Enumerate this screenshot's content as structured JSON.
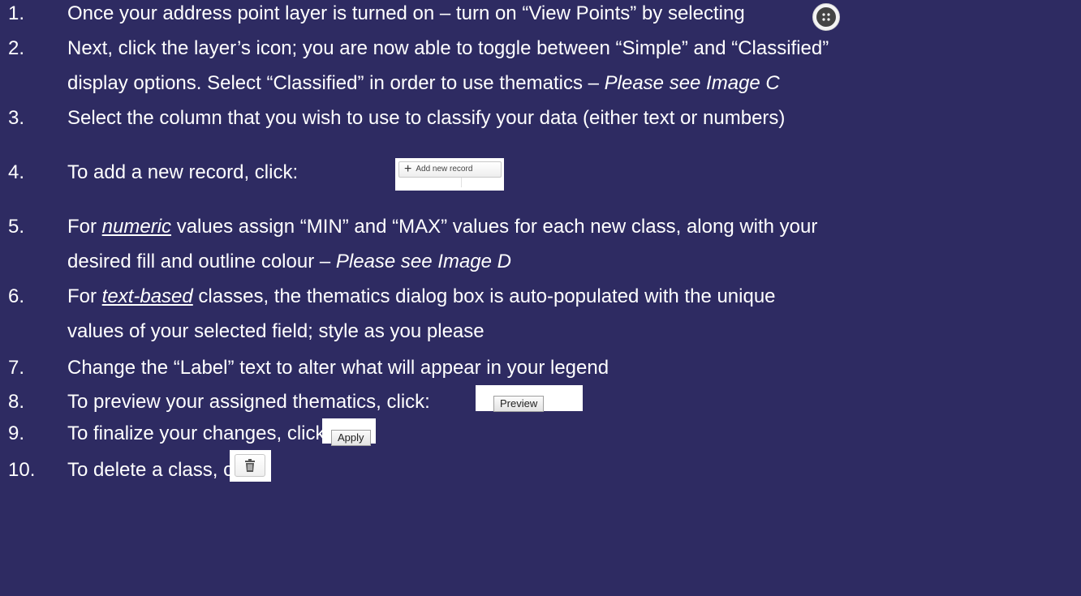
{
  "items": [
    {
      "num": "1.",
      "text": "Once your address point layer is turned on – turn on “View Points” by selecting"
    },
    {
      "num": "2.",
      "line1": "Next, click the layer’s icon; you are now able to toggle between “Simple” and “Classified”",
      "line2_a": "display options.  Select “Classified” in order to use thematics – ",
      "line2_em": "Please see Image C"
    },
    {
      "num": "3.",
      "text": "Select the column that you wish to use to classify your data (either text or numbers)"
    },
    {
      "num": "4.",
      "text": "To add a new record, click:"
    },
    {
      "num": "5.",
      "line1_a": "For ",
      "line1_em": "numeric",
      "line1_b": " values assign “MIN” and “MAX” values for each new class, along with your",
      "line2_a": "desired fill and outline colour – ",
      "line2_em": "Please see Image D"
    },
    {
      "num": "6.",
      "line1_a": "For ",
      "line1_em": "text-based",
      "line1_b": " classes, the thematics dialog box is auto-populated with the unique",
      "line2": "values of your selected field; style as you please"
    },
    {
      "num": "7.",
      "text": "Change the “Label” text to alter what will appear in your legend"
    },
    {
      "num": "8.",
      "text": "To preview your assigned thematics, click:"
    },
    {
      "num": "9.",
      "text": "To finalize your changes, click:"
    },
    {
      "num": "10.",
      "text": "To delete a class, click:"
    }
  ],
  "buttons": {
    "view_points_icon": "view-points-icon",
    "add_record": {
      "plus": "+",
      "label": "Add new record"
    },
    "preview_label": "Preview",
    "apply_label": "Apply",
    "delete_icon": "trash-icon"
  },
  "colors": {
    "background": "#2e2b62",
    "text": "#ffffff"
  }
}
